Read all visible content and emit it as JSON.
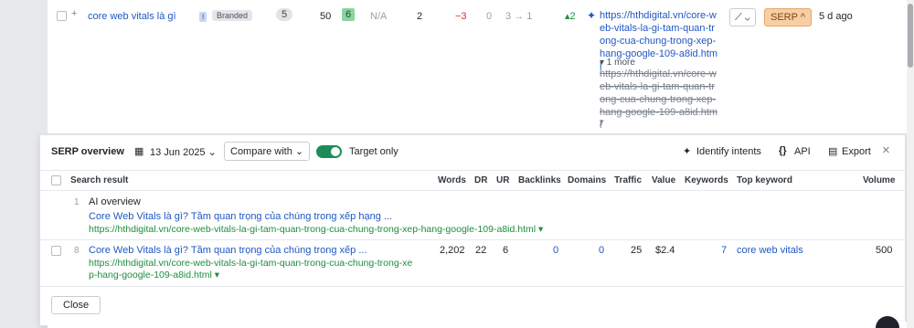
{
  "top_row": {
    "keyword": "core web vitals là gì",
    "intent_tag": "I",
    "branded_tag": "Branded",
    "kd": "5",
    "volume": "50",
    "tp": "6",
    "na": "N/A",
    "position": "2",
    "change": "−3",
    "zero": "0",
    "pos_change": "3 → 1",
    "up_change": "▴2",
    "url_current": "https://hthdigital.vn/core-web-vitals-la-gi-tam-quan-trong-cua-chung-trong-xep-hang-google-109-a8id.html",
    "more": "▾ 1 more",
    "url_old": "https://hthdigital.vn/core-web-vitals-la-gi-tam-quan-trong-cua-chung-trong-xep-hang-google-109-a8id.html",
    "old_caret": "▾",
    "chart_btn": "⟋ ⌄",
    "serp_btn": "SERP ^",
    "updated": "5 d ago"
  },
  "panel": {
    "title": "SERP overview",
    "date": "13 Jun 2025",
    "compare": "Compare with",
    "target_only": "Target only",
    "identify_intents": "Identify intents",
    "api": "API",
    "export": "Export",
    "close_x": "×",
    "columns": [
      "Search result",
      "Words",
      "DR",
      "UR",
      "Backlinks",
      "Domains",
      "Traffic",
      "Value",
      "Keywords",
      "Top keyword",
      "Volume"
    ],
    "rows": [
      {
        "pos": "1",
        "type": "AI overview",
        "title": "Core Web Vitals là gì? Tầm quan trọng của chúng trong xếp hạng ...",
        "url": "https://hthdigital.vn/core-web-vitals-la-gi-tam-quan-trong-cua-chung-trong-xep-hang-google-109-a8id.html ▾"
      },
      {
        "pos": "8",
        "title": "Core Web Vitals là gì? Tầm quan trọng của chúng trong xếp ...",
        "url1": "https://hthdigital.vn/core-web-vitals-la-gi-tam-quan-trong-cua-chung-trong-xe",
        "url2": "p-hang-google-109-a8id.html ▾",
        "words": "2,202",
        "dr": "22",
        "ur": "6",
        "backlinks": "0",
        "domains": "0",
        "traffic": "25",
        "value": "$2.4",
        "keywords": "7",
        "top_keyword": "core web vitals",
        "volume": "500"
      }
    ],
    "close_button": "Close"
  },
  "colors": {
    "accent": "#1f57c4",
    "green_url": "#1d8d3f",
    "toggle": "#1c8d5a",
    "serp": "#f6cfa4"
  }
}
